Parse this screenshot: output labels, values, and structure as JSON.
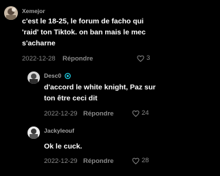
{
  "comments": [
    {
      "username": "Xemejor",
      "text": "c'est le 18-25, le forum de facho qui 'raid' ton Tiktok. on ban mais le mec s'acharne",
      "date": "2022-12-28",
      "reply_label": "Répondre",
      "likes": "3",
      "verified": false
    },
    {
      "username": "Desc0",
      "text": "d'accord le white knight, Paz sur ton être ceci dit",
      "date": "2022-12-29",
      "reply_label": "Répondre",
      "likes": "24",
      "verified": true
    },
    {
      "username": "Jackyleouf",
      "text": "Ok le cuck.",
      "date": "2022-12-29",
      "reply_label": "Répondre",
      "likes": "28",
      "verified": false
    }
  ],
  "colors": {
    "background": "#000000",
    "username": "#a3a3a3",
    "meta": "#8a8a8a",
    "badge": "#20d5ec"
  },
  "icons": {
    "like": "heart-outline-icon",
    "badge": "verified-badge-icon"
  }
}
